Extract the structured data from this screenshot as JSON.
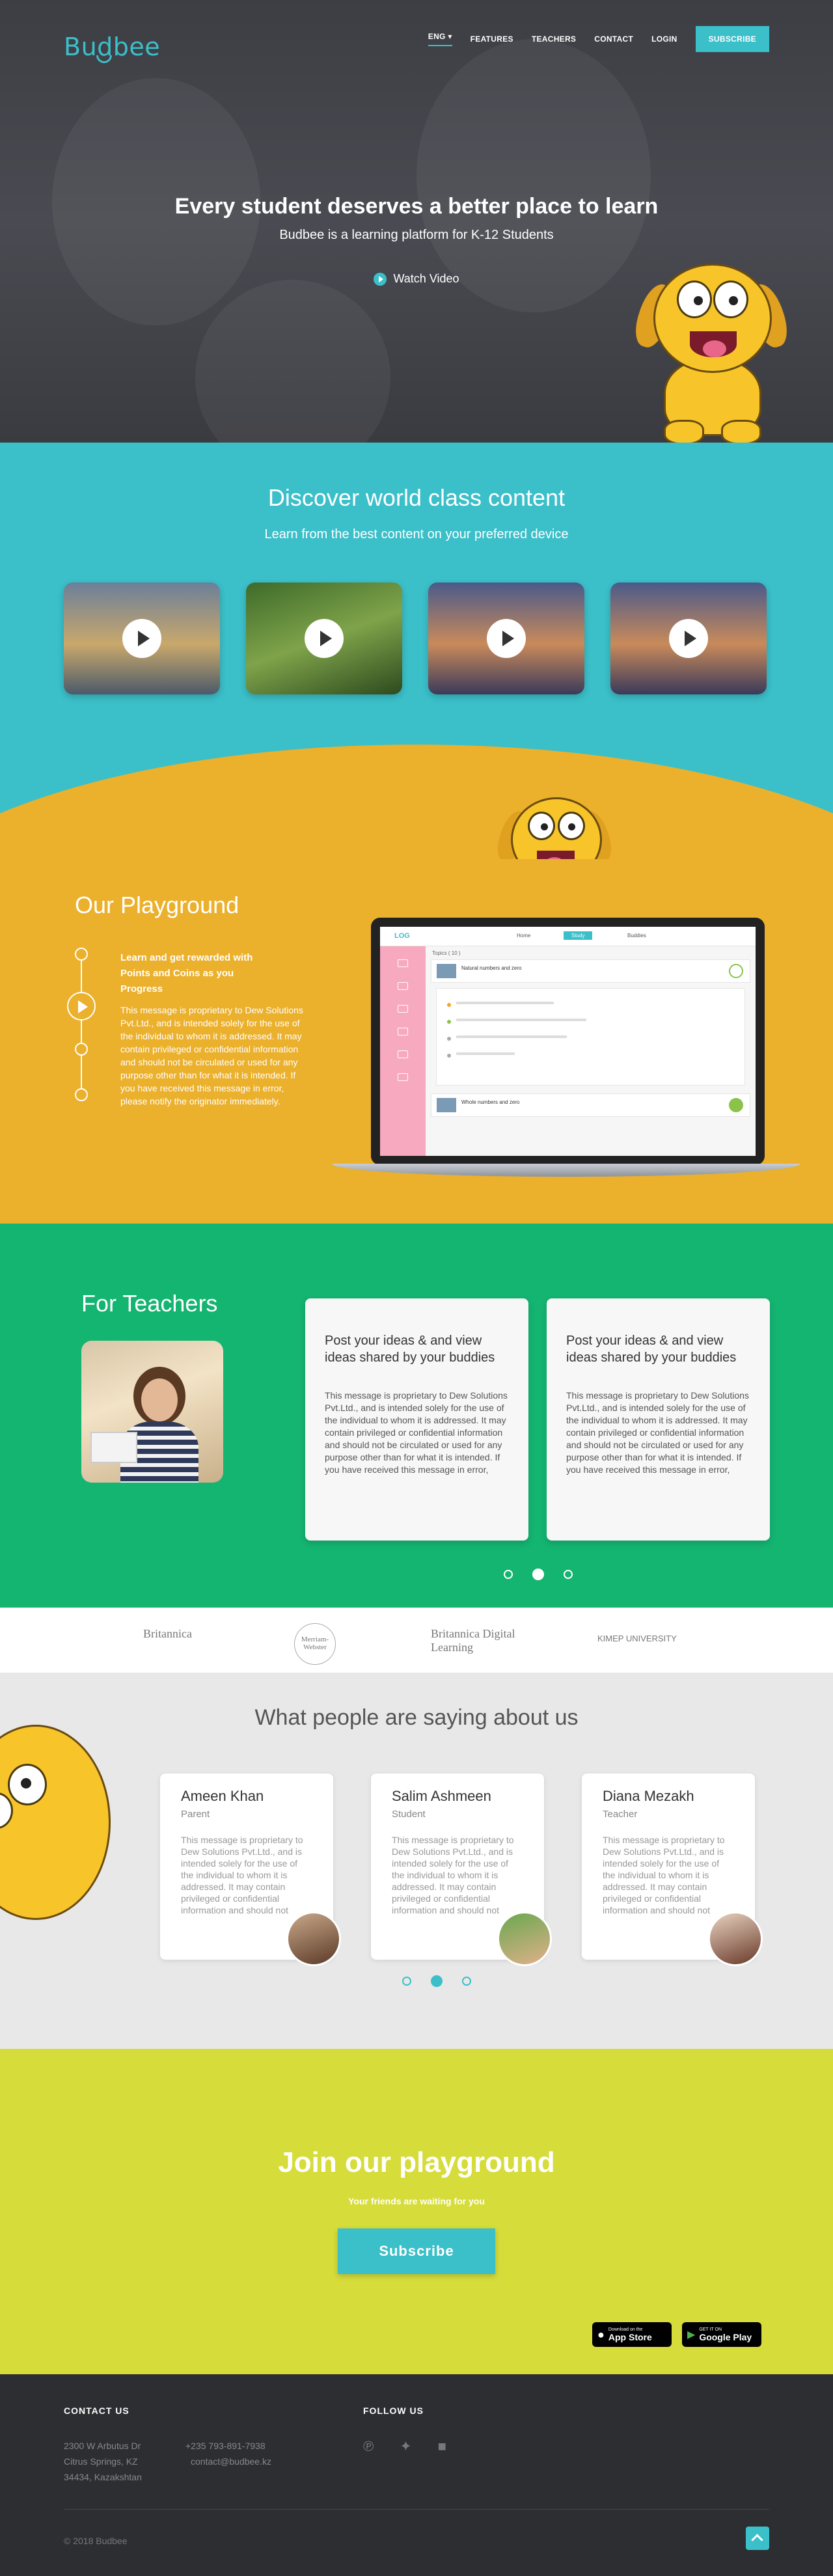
{
  "brand": {
    "name": "Budbee",
    "accent": "#3bbfc9"
  },
  "nav": {
    "language": "ENG",
    "items": [
      "FEATURES",
      "TEACHERS",
      "CONTACT",
      "LOGIN"
    ],
    "subscribe": "SUBSCRIBE"
  },
  "hero": {
    "title": "Every student deserves a better place to learn",
    "subtitle": "Budbee is a learning platform for K-12 Students",
    "watch_label": "Watch Video"
  },
  "discover": {
    "title": "Discover  world class content",
    "subtitle": "Learn from the best content on your preferred device",
    "video_icon": "play-icon"
  },
  "playground": {
    "title": "Our Playground",
    "rewarded": "Learn and get rewarded with Points and Coins as you Progress",
    "body": "This message is proprietary to Dew Solutions Pvt.Ltd., and is intended solely for the use of the individual to whom it is addressed. It may contain privileged or confidential information and should not be circulated or used for any purpose other than for what it is intended. If you have received this message in error, please notify the originator immediately.",
    "app": {
      "logo": "LOG",
      "tabs": [
        "Home",
        "Study",
        "Buddies"
      ],
      "topics": "Topics ( 10 )",
      "items": [
        "Natural numbers and zero",
        "Whole numbers and zero"
      ]
    }
  },
  "teachers": {
    "title": "For Teachers",
    "cards": [
      {
        "title": "Post your ideas & and view ideas shared by your buddies",
        "body": "This message is proprietary to Dew Solutions Pvt.Ltd., and is intended solely for the use of the individual to whom it is addressed. It may contain privileged or confidential information and should not be circulated or used for any purpose other than for what it is intended. If you have received this message in error,"
      },
      {
        "title": "Post your ideas & and view ideas shared by your buddies",
        "body": "This message is proprietary to Dew Solutions Pvt.Ltd., and is intended solely for the use of the individual to whom it is addressed. It may contain privileged or confidential information and should not be circulated or used for any purpose other than for what it is intended. If you have received this message in error,"
      }
    ]
  },
  "partners": [
    "Britannica",
    "Merriam-Webster",
    "Britannica Digital Learning",
    "KIMEP UNIVERSITY"
  ],
  "testimonials": {
    "title": "What people are saying about us",
    "items": [
      {
        "name": "Ameen Khan",
        "role": "Parent",
        "text": "This message is proprietary to Dew Solutions Pvt.Ltd., and is intended solely for the use of the individual to whom it is addressed. It may contain privileged or confidential information and should not"
      },
      {
        "name": "Salim Ashmeen",
        "role": "Student",
        "text": "This message is proprietary to Dew Solutions Pvt.Ltd., and is intended solely for the use of the individual to whom it is addressed. It may contain privileged or confidential information and should not"
      },
      {
        "name": "Diana Mezakh",
        "role": "Teacher",
        "text": "This message is proprietary to Dew Solutions Pvt.Ltd., and is intended solely for the use of the individual to whom it is addressed. It may contain privileged or confidential information and should not"
      }
    ]
  },
  "join": {
    "title": "Join our playground",
    "subtitle": "Your friends are waiting for you",
    "button": "Subscribe",
    "appstore_small": "Download on the",
    "appstore_big": "App Store",
    "googleplay_small": "GET IT ON",
    "googleplay_big": "Google Play"
  },
  "footer": {
    "contact_title": "CONTACT US",
    "address": [
      "2300 W Arbutus Dr",
      "Citrus Springs, KZ",
      "34434, Kazakshtan"
    ],
    "phone": "+235 793-891-7938",
    "email": "contact@budbee.kz",
    "follow_title": "FOLLOW US",
    "copyright": "© 2018 Budbee"
  }
}
